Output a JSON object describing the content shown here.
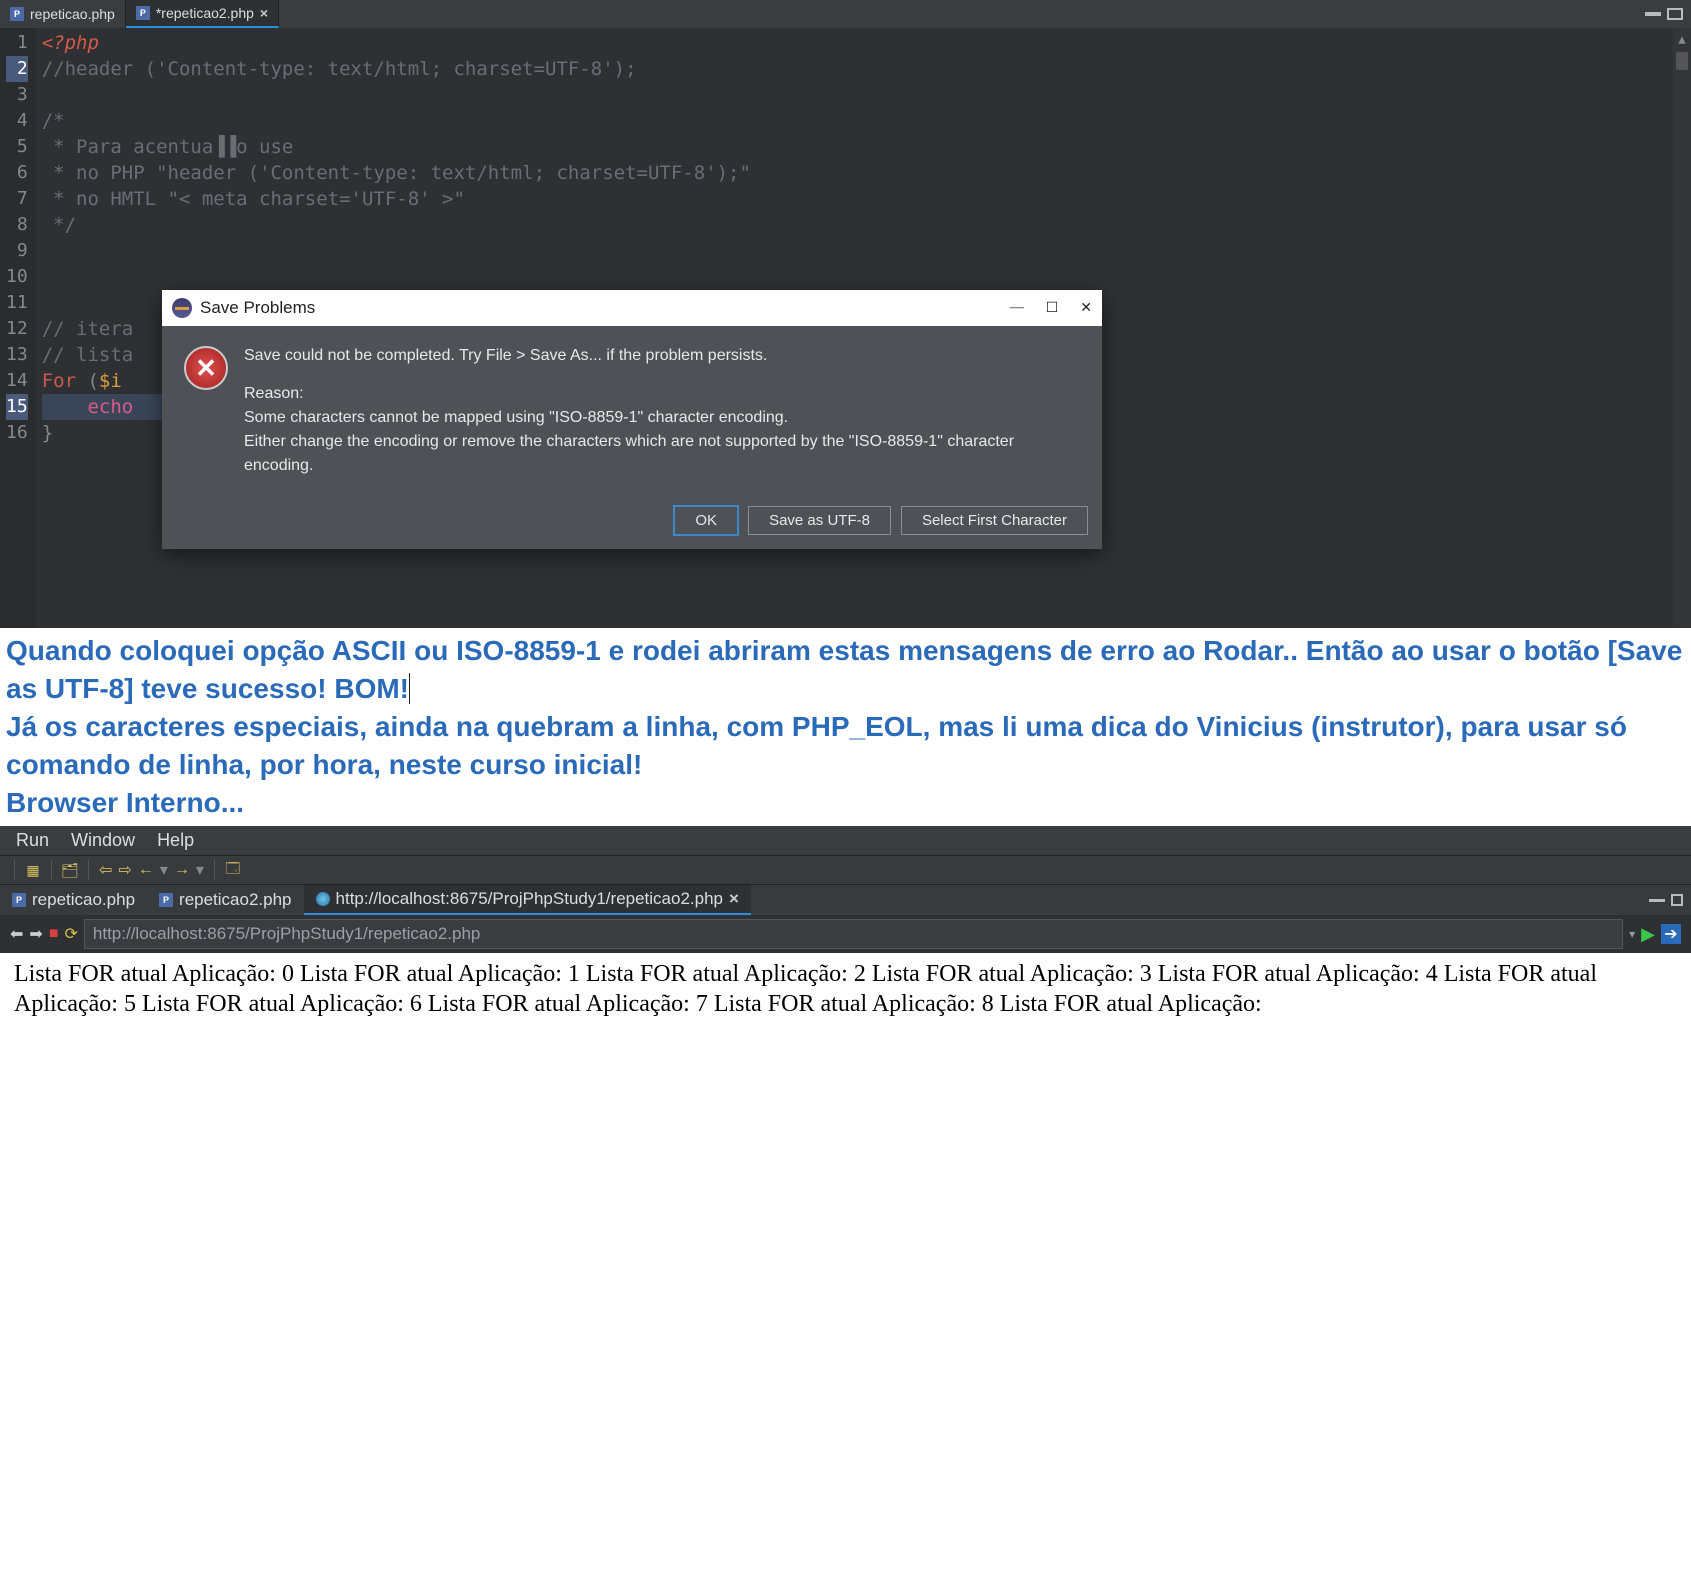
{
  "tabs": [
    {
      "label": "repeticao.php"
    },
    {
      "label": "*repeticao2.php"
    }
  ],
  "gutter": [
    "1",
    "2",
    "3",
    "4",
    "5",
    "6",
    "7",
    "8",
    "9",
    "10",
    "11",
    "12",
    "13",
    "14",
    "15",
    "16"
  ],
  "code": {
    "l1a": "<?php",
    "l2": "//header ('Content-type: text/html; charset=UTF-8');",
    "l4": "/*",
    "l5": " * Para acentua▐▐o use",
    "l6": " * no PHP \"header ('Content-type: text/html; charset=UTF-8');\"",
    "l7": " * no HMTL \"< meta charset='UTF-8' >\"",
    "l8": " */",
    "l12": "// itera",
    "l13": "// lista",
    "l14a": "For ",
    "l14b": "(",
    "l14c": "$i ",
    "l15a": "    ",
    "l15b": "echo",
    "l16": "}"
  },
  "dialog": {
    "title": "Save Problems",
    "line1": "Save could not be completed. Try File > Save As... if the problem persists.",
    "reason_label": "Reason:",
    "reason1": "Some characters cannot be mapped using \"ISO-8859-1\" character encoding.",
    "reason2": "Either change the encoding or remove the characters which are not supported by the \"ISO-8859-1\" character encoding.",
    "ok": "OK",
    "utf8": "Save as UTF-8",
    "select": "Select First Character"
  },
  "commentary": {
    "p1": "Quando coloquei opção ASCII ou ISO-8859-1 e rodei abriram estas mensagens de erro ao Rodar.. Então ao usar o botão [Save as UTF-8] teve sucesso!  BOM!",
    "p2": "Já os caracteres especiais, ainda na quebram a linha, com PHP_EOL, mas li uma dica do Vinicius (instrutor), para usar só comando de linha, por hora, neste curso inicial!",
    "p3": "Browser Interno..."
  },
  "menu": {
    "run": "Run",
    "window": "Window",
    "help": "Help"
  },
  "tabs2": [
    {
      "label": "repeticao.php"
    },
    {
      "label": "repeticao2.php"
    },
    {
      "label": "http://localhost:8675/ProjPhpStudy1/repeticao2.php"
    }
  ],
  "url": "http://localhost:8675/ProjPhpStudy1/repeticao2.php",
  "output": "Lista FOR atual Aplicação: 0 Lista FOR atual Aplicação: 1 Lista FOR atual Aplicação: 2 Lista FOR atual Aplicação: 3 Lista FOR atual Aplicação: 4 Lista FOR atual Aplicação: 5 Lista FOR atual Aplicação: 6 Lista FOR atual Aplicação: 7 Lista FOR atual Aplicação: 8 Lista FOR atual Aplicação:"
}
